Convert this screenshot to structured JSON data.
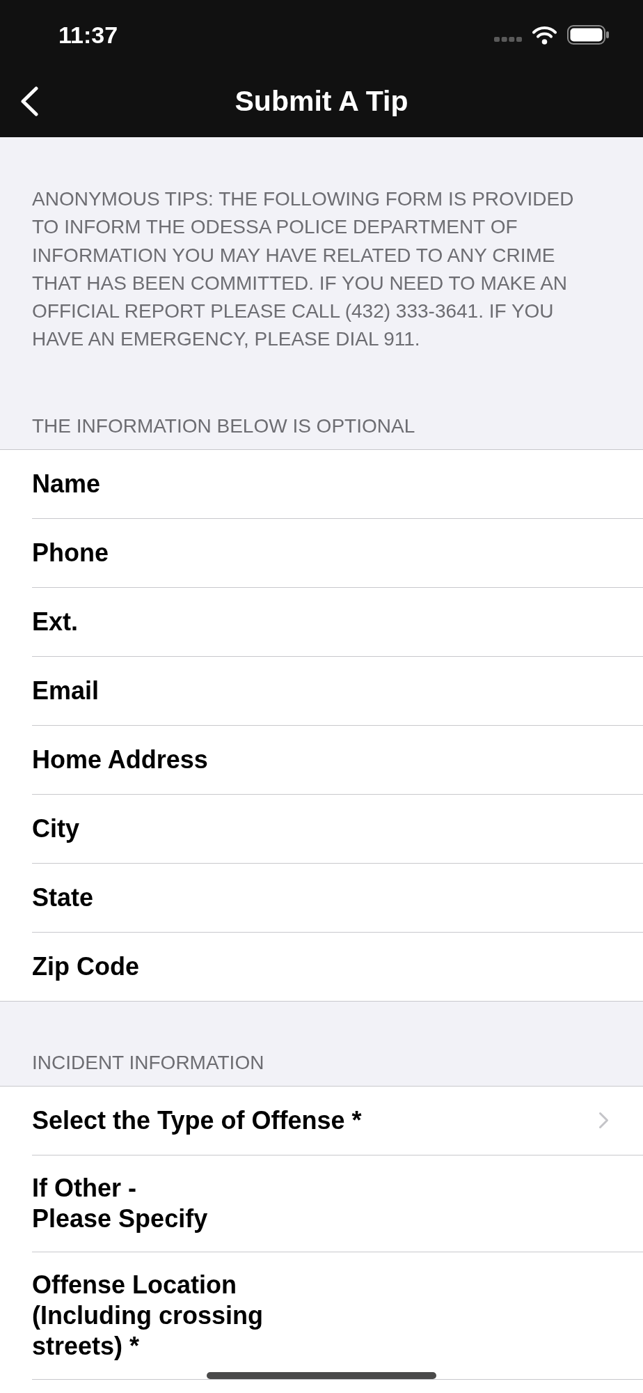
{
  "status_bar": {
    "time": "11:37"
  },
  "nav_bar": {
    "title": "Submit A Tip"
  },
  "notice": "ANONYMOUS TIPS: THE FOLLOWING FORM IS PROVIDED TO INFORM THE ODESSA POLICE DEPARTMENT OF INFORMATION YOU MAY HAVE RELATED TO ANY CRIME THAT HAS BEEN COMMITTED. IF YOU NEED TO MAKE AN OFFICIAL REPORT PLEASE CALL (432) 333-3641. IF YOU HAVE AN EMERGENCY, PLEASE DIAL 911.",
  "sections": [
    {
      "header": "THE INFORMATION BELOW IS OPTIONAL",
      "rows": [
        {
          "kind": "text",
          "label": "Name"
        },
        {
          "kind": "text",
          "label": "Phone"
        },
        {
          "kind": "text",
          "label": "Ext."
        },
        {
          "kind": "text",
          "label": "Email"
        },
        {
          "kind": "text",
          "label": "Home Address"
        },
        {
          "kind": "text",
          "label": "City"
        },
        {
          "kind": "text",
          "label": "State"
        },
        {
          "kind": "text",
          "label": "Zip Code"
        }
      ]
    },
    {
      "header": "INCIDENT INFORMATION",
      "rows": [
        {
          "kind": "picker",
          "label": "Select the Type of Offense *"
        },
        {
          "kind": "text",
          "label": "If Other -\nPlease Specify"
        },
        {
          "kind": "text",
          "label": "Offense Location (Including crossing streets) *"
        }
      ]
    }
  ]
}
